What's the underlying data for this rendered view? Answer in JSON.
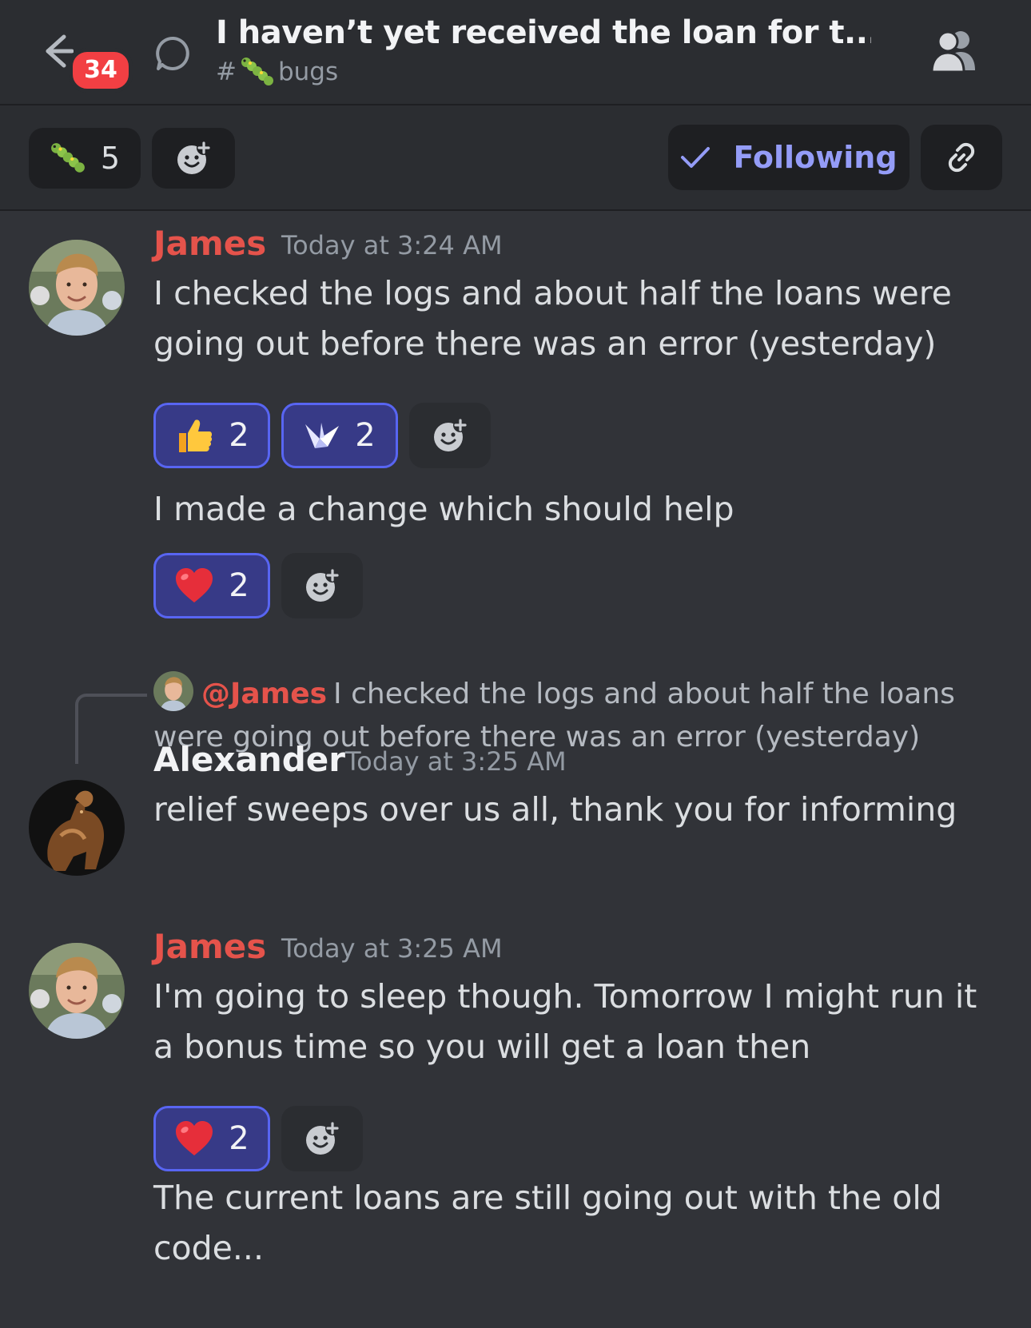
{
  "header": {
    "unread_count": "34",
    "title": "I haven’t yet received the loan for t...",
    "channel_hash": "#",
    "channel_name": "bugs"
  },
  "toolbar": {
    "tag_count": "5",
    "following_label": "Following"
  },
  "messages": [
    {
      "author": "James",
      "timestamp": "Today at 3:24 AM",
      "lines": [
        {
          "text": "I checked the logs and about half the loans were going out before there was an error (yesterday)",
          "reactions": [
            {
              "emoji": "👍",
              "count": "2"
            },
            {
              "emoji": "crane",
              "count": "2"
            }
          ]
        },
        {
          "text": "I made a change which should help",
          "reactions": [
            {
              "emoji": "❤️",
              "count": "2"
            }
          ]
        }
      ]
    },
    {
      "reply_to": {
        "mention": "@James",
        "text": "I checked the logs and about half the loans were going out before there was an error (yesterday)"
      },
      "author": "Alexander",
      "timestamp": "Today at 3:25 AM",
      "lines": [
        {
          "text": "relief sweeps over us all, thank you for informing"
        }
      ]
    },
    {
      "author": "James",
      "timestamp": "Today at 3:25 AM",
      "lines": [
        {
          "text": "I'm going to sleep though. Tomorrow I might run it a bonus time so you will get a loan then",
          "reactions": [
            {
              "emoji": "❤️",
              "count": "2"
            }
          ]
        },
        {
          "text": "The current loans are still going out with the old code..."
        }
      ]
    }
  ],
  "colors": {
    "background": "#313338",
    "header": "#2b2d31",
    "accent": "#5865f2",
    "following": "#949cf7",
    "author_james": "#e5534b",
    "badge": "#f23f43"
  },
  "icons": [
    "back-arrow-icon",
    "thread-icon",
    "caterpillar-icon",
    "add-reaction-icon",
    "checkmark-icon",
    "link-icon",
    "members-icon"
  ]
}
